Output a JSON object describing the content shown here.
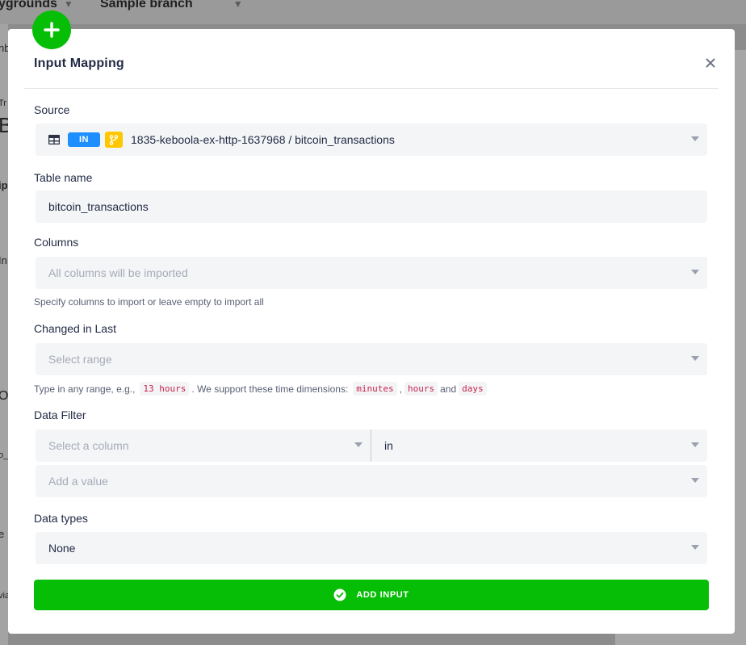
{
  "background": {
    "crumb_left": "ygrounds",
    "crumb_branch": "Sample branch",
    "left_fragments": [
      "nb",
      "Tr",
      "B",
      "ip",
      "In",
      "O",
      "o_",
      "e",
      "via"
    ]
  },
  "modal": {
    "title": "Input Mapping",
    "source": {
      "label": "Source",
      "stage_badge": "IN",
      "value": "1835-keboola-ex-http-1637968 / bitcoin_transactions"
    },
    "table_name": {
      "label": "Table name",
      "value": "bitcoin_transactions"
    },
    "columns": {
      "label": "Columns",
      "placeholder": "All columns will be imported",
      "help": "Specify columns to import or leave empty to import all"
    },
    "changed_in_last": {
      "label": "Changed in Last",
      "placeholder": "Select range",
      "help_prefix": "Type in any range, e.g.,",
      "example": "13 hours",
      "help_middle": ". We support these time dimensions:",
      "dim_minutes": "minutes",
      "dim_hours": "hours",
      "help_and": "and",
      "dim_days": "days"
    },
    "data_filter": {
      "label": "Data Filter",
      "column_placeholder": "Select a column",
      "operator": "in",
      "value_placeholder": "Add a value"
    },
    "data_types": {
      "label": "Data types",
      "value": "None"
    },
    "submit_label": "ADD INPUT"
  },
  "colors": {
    "accent_green": "#07be07",
    "badge_blue": "#1f8fff",
    "branch_yellow": "#ffc700"
  }
}
